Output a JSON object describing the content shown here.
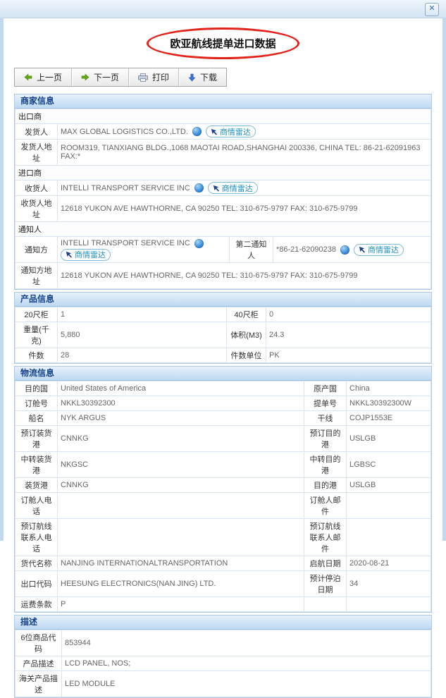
{
  "window": {
    "close_glyph": "✕"
  },
  "page_title": "欧亚航线提单进口数据",
  "toolbar": {
    "prev_label": "上一页",
    "next_label": "下一页",
    "print_label": "打印",
    "download_label": "下载"
  },
  "badge_label": "商情雷达",
  "merchant": {
    "title": "商家信息",
    "exporter_header": "出口商",
    "shipper_label": "发货人",
    "shipper_value": "MAX GLOBAL LOGISTICS CO.,LTD.",
    "shipper_addr_label": "发货人地址",
    "shipper_addr_value": "ROOM319, TIANXIANG BLDG.,1068 MAOTAI ROAD,SHANGHAI 200336, CHINA TEL: 86-21-62091963 FAX:*",
    "importer_header": "进口商",
    "consignee_label": "收货人",
    "consignee_value": "INTELLI TRANSPORT SERVICE INC",
    "consignee_addr_label": "收货人地址",
    "consignee_addr_value": "12618 YUKON AVE HAWTHORNE, CA 90250 TEL: 310-675-9797 FAX: 310-675-9799",
    "notify_header": "通知人",
    "notify_label": "通知方",
    "notify_value": "INTELLI TRANSPORT SERVICE INC",
    "second_notify_label": "第二通知人",
    "second_notify_value": "*86-21-62090238",
    "notify_addr_label": "通知方地址",
    "notify_addr_value": "12618 YUKON AVE HAWTHORNE, CA 90250 TEL: 310-675-9797 FAX: 310-675-9799"
  },
  "product": {
    "title": "产品信息",
    "rows": [
      {
        "l1": "20尺柜",
        "v1": "1",
        "l2": "40尺柜",
        "v2": "0"
      },
      {
        "l1": "重量(千克)",
        "v1": "5,880",
        "l2": "体积(M3)",
        "v2": "24.3"
      },
      {
        "l1": "件数",
        "v1": "28",
        "l2": "件数单位",
        "v2": "PK"
      }
    ]
  },
  "logistics": {
    "title": "物流信息",
    "rows": [
      {
        "l1": "目的国",
        "v1": "United States of America",
        "l2": "原产国",
        "v2": "China"
      },
      {
        "l1": "订舱号",
        "v1": "NKKL30392300",
        "l2": "提单号",
        "v2": "NKKL30392300W"
      },
      {
        "l1": "船名",
        "v1": "NYK ARGUS",
        "l2": "干线",
        "v2": "COJP1553E"
      },
      {
        "l1": "预订装货港",
        "v1": "CNNKG",
        "l2": "预订目的港",
        "v2": "USLGB"
      },
      {
        "l1": "中转装货港",
        "v1": "NKGSC",
        "l2": "中转目的港",
        "v2": "LGBSC"
      },
      {
        "l1": "装货港",
        "v1": "CNNKG",
        "l2": "目的港",
        "v2": "USLGB"
      },
      {
        "l1": "订舱人电话",
        "v1": "",
        "l2": "订舱人邮件",
        "v2": ""
      },
      {
        "l1": "预订航线联系人电话",
        "v1": "",
        "l2": "预订航线联系人邮件",
        "v2": ""
      },
      {
        "l1": "货代名称",
        "v1": "NANJING INTERNATIONALTRANSPORTATION",
        "l2": "启航日期",
        "v2": "2020-08-21"
      },
      {
        "l1": "出口代码",
        "v1": "HEESUNG ELECTRONICS(NAN JING) LTD.",
        "l2": "预计停泊日期",
        "v2": "34"
      },
      {
        "l1": "运费条款",
        "v1": "P",
        "l2": "",
        "v2": ""
      }
    ]
  },
  "description": {
    "title": "描述",
    "rows": [
      {
        "l": "6位商品代码",
        "v": "853944"
      },
      {
        "l": "产品描述",
        "v": "LCD PANEL, NOS;"
      },
      {
        "l": "海关产品描述",
        "v": "LED MODULE"
      }
    ]
  },
  "colors": {
    "accent_header": "#15428b",
    "badge_text": "#1d8fc0",
    "ellipse_red": "#e2231a",
    "frame_blue": "#c2d8ee"
  }
}
